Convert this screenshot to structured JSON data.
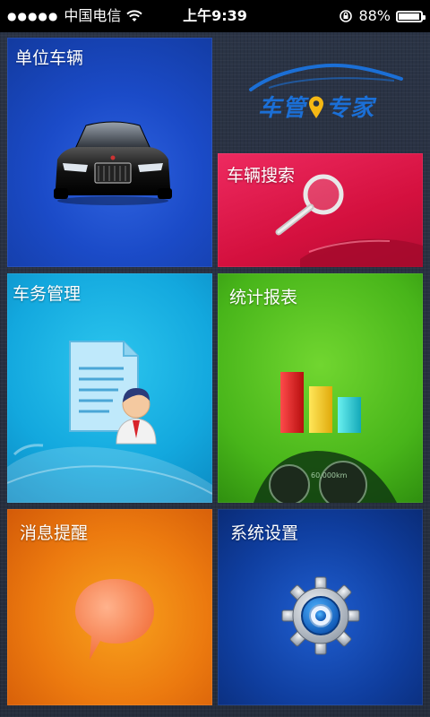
{
  "status_bar": {
    "signal": "●●●●●",
    "carrier": "中国电信",
    "time": "上午9:39",
    "battery_text": "88%",
    "battery_level": 0.88
  },
  "logo": {
    "text": "车管",
    "text2": "专家"
  },
  "tiles": {
    "unit_vehicles": {
      "label": "单位车辆",
      "color": "#1b4bc8"
    },
    "vehicle_search": {
      "label": "车辆搜索",
      "color": "#d4103e"
    },
    "vehicle_affairs": {
      "label": "车务管理",
      "color": "#13a8de"
    },
    "statistics": {
      "label": "统计报表",
      "color": "#48b51a"
    },
    "messages": {
      "label": "消息提醒",
      "color": "#ec7a0f"
    },
    "settings": {
      "label": "系统设置",
      "color": "#0f3e9f"
    }
  },
  "icons": {
    "unit_vehicles": "car-icon",
    "vehicle_search": "magnifier-icon",
    "vehicle_affairs": "document-person-icon",
    "statistics": "bar-chart-icon",
    "messages": "speech-bubble-icon",
    "settings": "gear-icon"
  },
  "dashboard_readout": "60,000km"
}
